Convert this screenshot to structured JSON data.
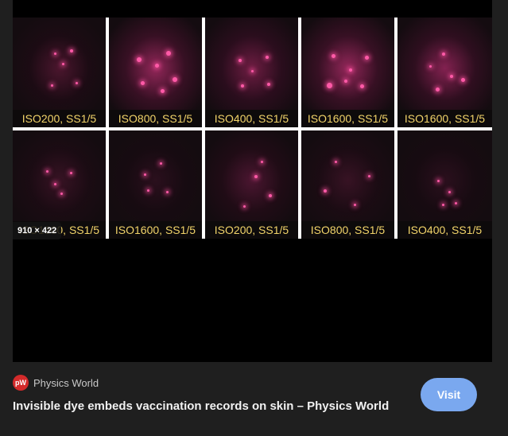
{
  "image": {
    "dimensions_badge": "910 × 422",
    "panels_top": [
      {
        "label": "ISO200, SS1/5"
      },
      {
        "label": "ISO800, SS1/5"
      },
      {
        "label": "ISO400, SS1/5"
      },
      {
        "label": "ISO1600, SS1/5"
      },
      {
        "label": "ISO1600, SS1/5"
      }
    ],
    "panels_bottom": [
      {
        "label": "ISO1600, SS1/5"
      },
      {
        "label": "ISO1600, SS1/5"
      },
      {
        "label": "ISO200, SS1/5"
      },
      {
        "label": "ISO800, SS1/5"
      },
      {
        "label": "ISO400, SS1/5"
      }
    ],
    "label_color": "#f2d46a",
    "dot_color": "#ff5aa8"
  },
  "source": {
    "favicon_text": "pW",
    "name": "Physics World"
  },
  "title": "Invisible dye embeds vaccination records on skin – Physics World",
  "visit_label": "Visit",
  "colors": {
    "background": "#1f1f1f",
    "accent": "#7aa8ef"
  }
}
